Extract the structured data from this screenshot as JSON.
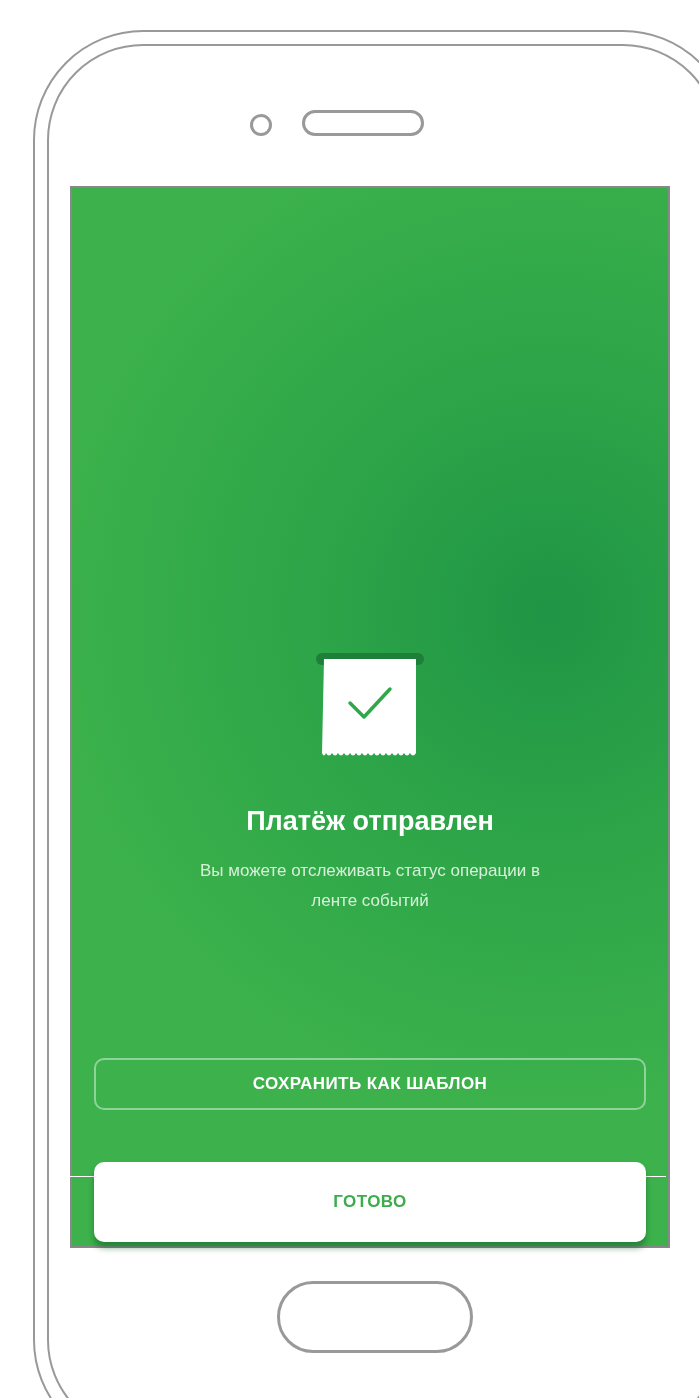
{
  "screen": {
    "title": "Платёж отправлен",
    "message": "Вы можете отслеживать статус операции в ленте событий",
    "buttons": [
      {
        "label": "СОХРАНИТЬ КАК ШАБЛОН",
        "kind": "outline"
      },
      {
        "label": "ГОТОВО",
        "kind": "primary"
      }
    ]
  }
}
